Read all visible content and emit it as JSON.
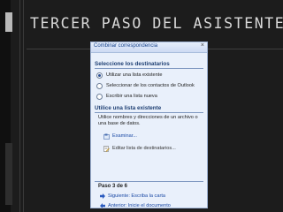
{
  "slide": {
    "title": "TERCER PASO DEL ASISTENTE"
  },
  "pane": {
    "title": "Combinar correspondencia",
    "section1_title": "Seleccione los destinatarios",
    "options": [
      {
        "label": "Utilizar una lista existente",
        "selected": true
      },
      {
        "label": "Seleccionar de los contactos de Outlook",
        "selected": false
      },
      {
        "label": "Escribir una lista nueva",
        "selected": false
      }
    ],
    "section2_title": "Utilice una lista existente",
    "description": "Utilice nombres y direcciones de un archivo o una base de datos.",
    "browse_label": "Examinar...",
    "edit_label": "Editar lista de destinatarios...",
    "step_label": "Paso 3 de 6",
    "next_label": "Siguiente: Escriba la carta",
    "prev_label": "Anterior: Inicie el documento"
  },
  "colors": {
    "slide_background": "#1c1c1c",
    "title_text": "#d9d9d9",
    "pane_background": "#e9f0fb",
    "link": "#1b4aa5"
  }
}
